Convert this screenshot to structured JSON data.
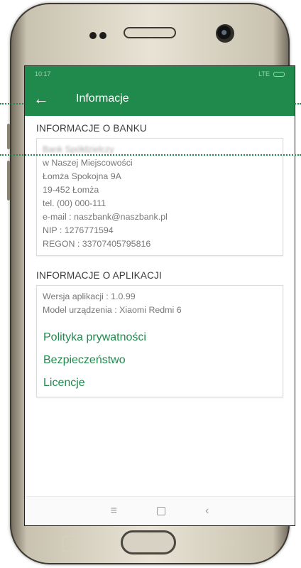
{
  "status_bar": {
    "time": "10:17",
    "network": "LTE"
  },
  "app_bar": {
    "title": "Informacje"
  },
  "bank_section": {
    "title": "INFORMACJE O BANKU",
    "lines": [
      "Bank Spółdzielczy",
      "w Naszej Miejscowości",
      "Łomża Spokojna 9A",
      "19-452 Łomża",
      "tel. (00) 000-111",
      "e-mail : naszbank@naszbank.pl",
      "NIP : 1276771594",
      "REGON : 33707405795816"
    ]
  },
  "app_section": {
    "title": "INFORMACJE O APLIKACJI",
    "version": "Wersja aplikacji : 1.0.99",
    "device": "Model urządzenia : Xiaomi Redmi 6",
    "links": [
      "Polityka prywatności",
      "Bezpieczeństwo",
      "Licencje"
    ]
  },
  "colors": {
    "accent": "#1f8a4c"
  },
  "icons": [
    "back-arrow-icon",
    "battery-icon",
    "menu-icon",
    "home-icon",
    "back-icon"
  ]
}
